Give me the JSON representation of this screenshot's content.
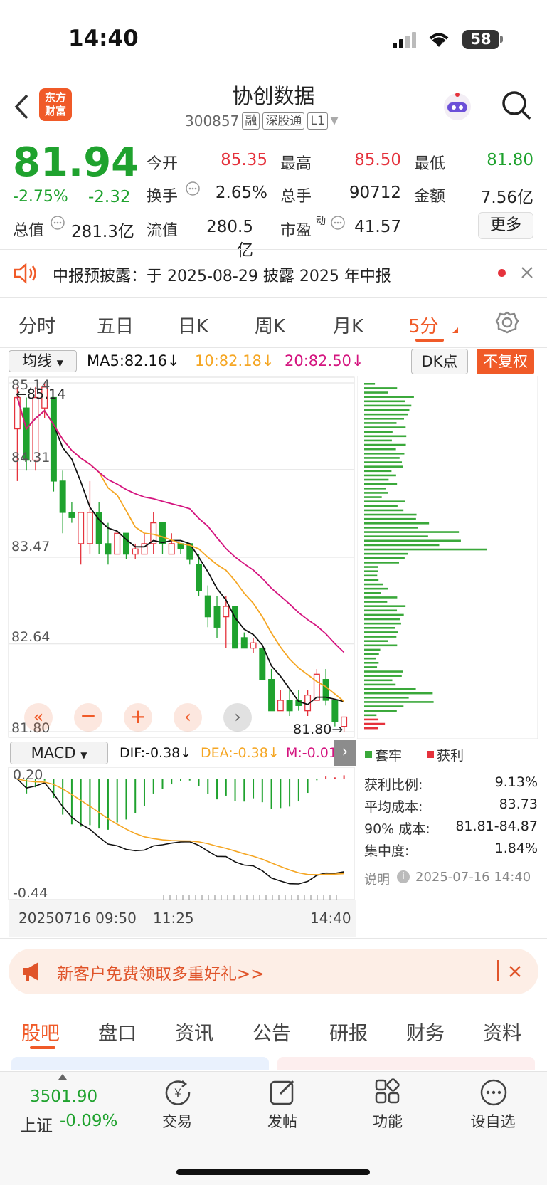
{
  "status": {
    "time": "14:40",
    "battery": "58"
  },
  "header": {
    "logo_line1": "东方",
    "logo_line2": "财富",
    "name": "协创数据",
    "code": "300857",
    "tags": [
      "融",
      "深股通",
      "L1"
    ]
  },
  "quote": {
    "price": "81.94",
    "change_pct": "-2.75%",
    "change": "-2.32",
    "open_label": "今开",
    "open": "85.35",
    "high_label": "最高",
    "high": "85.50",
    "low_label": "最低",
    "low": "81.80",
    "turnover_label": "换手",
    "turnover": "2.65%",
    "volume_label": "总手",
    "volume": "90712",
    "amount_label": "金额",
    "amount": "7.56亿",
    "mcap_label": "总值",
    "mcap": "281.3亿",
    "float_label": "流值",
    "float": "280.5亿",
    "pe_label": "市盈",
    "pe_sup": "动",
    "pe": "41.57",
    "more": "更多"
  },
  "notice": {
    "text": "中报预披露：于 2025-08-29 披露 2025 年中报"
  },
  "tabs": [
    "分时",
    "五日",
    "日K",
    "周K",
    "月K",
    "5分"
  ],
  "indicators": {
    "ma_select": "均线",
    "ma5": "MA5:82.16↓",
    "ma10": "10:82.18↓",
    "ma20": "20:82.50↓",
    "dk": "DK点",
    "fq": "不复权"
  },
  "chart_data": {
    "type": "candlestick",
    "y_ticks": [
      "85.14",
      "84.31",
      "83.47",
      "82.64",
      "81.80"
    ],
    "high_marker": "←85.14",
    "low_marker": "81.80→",
    "x_labels": [
      "20250716 09:50",
      "11:25",
      "14:40"
    ],
    "candles": [
      [
        84.7,
        85.1,
        84.2,
        85.0
      ],
      [
        84.9,
        85.0,
        84.3,
        84.4
      ],
      [
        84.4,
        85.1,
        84.3,
        85.0
      ],
      [
        84.9,
        85.14,
        84.8,
        85.1
      ],
      [
        85.0,
        85.0,
        84.1,
        84.2
      ],
      [
        84.2,
        84.3,
        83.7,
        83.9
      ],
      [
        83.9,
        84.0,
        83.8,
        83.85
      ],
      [
        83.6,
        83.9,
        83.4,
        83.9
      ],
      [
        83.6,
        84.2,
        83.5,
        83.9
      ],
      [
        83.9,
        84.0,
        83.5,
        83.6
      ],
      [
        83.6,
        83.8,
        83.4,
        83.5
      ],
      [
        83.5,
        83.7,
        83.5,
        83.7
      ],
      [
        83.7,
        83.7,
        83.45,
        83.5
      ],
      [
        83.5,
        83.6,
        83.45,
        83.55
      ],
      [
        83.5,
        83.7,
        83.5,
        83.6
      ],
      [
        83.6,
        83.9,
        83.5,
        83.8
      ],
      [
        83.8,
        83.8,
        83.5,
        83.6
      ],
      [
        83.5,
        83.7,
        83.5,
        83.6
      ],
      [
        83.6,
        83.6,
        83.5,
        83.55
      ],
      [
        83.6,
        83.6,
        83.4,
        83.45
      ],
      [
        83.4,
        83.5,
        83.1,
        83.15
      ],
      [
        83.1,
        83.2,
        82.8,
        82.9
      ],
      [
        83.0,
        83.1,
        82.7,
        82.8
      ],
      [
        82.9,
        83.1,
        82.6,
        83.0
      ],
      [
        83.0,
        83.0,
        82.7,
        82.6
      ],
      [
        82.7,
        82.75,
        82.6,
        82.6
      ],
      [
        82.6,
        82.7,
        82.55,
        82.65
      ],
      [
        82.6,
        82.6,
        82.3,
        82.3
      ],
      [
        82.3,
        82.4,
        82.0,
        82.0
      ],
      [
        82.0,
        82.2,
        82.0,
        82.1
      ],
      [
        82.1,
        82.2,
        81.95,
        82.0
      ],
      [
        82.1,
        82.2,
        82.0,
        82.05
      ],
      [
        82.0,
        82.2,
        81.95,
        82.15
      ],
      [
        82.1,
        82.4,
        82.1,
        82.35
      ],
      [
        82.3,
        82.4,
        82.05,
        82.1
      ],
      [
        82.1,
        82.1,
        81.85,
        81.9
      ],
      [
        81.85,
        81.9,
        81.8,
        81.94
      ]
    ],
    "macd_label": "MACD",
    "dif": "DIF:-0.38↓",
    "dea": "DEA:-0.38↓",
    "m": "M:-0.01",
    "macd_ticks": [
      "0.20",
      "-0.44"
    ]
  },
  "chip": {
    "legend_hold": "套牢",
    "legend_profit": "获利",
    "rows": [
      {
        "label": "获利比例:",
        "value": "9.13%"
      },
      {
        "label": "平均成本:",
        "value": "83.73"
      },
      {
        "label": "90% 成本:",
        "value": "81.81-84.87"
      },
      {
        "label": "集中度:",
        "value": "1.84%"
      }
    ],
    "note": "说明",
    "date": "2025-07-16 14:40"
  },
  "ad": {
    "text": "新客户免费领取多重好礼>>"
  },
  "bottom_tabs": [
    "股吧",
    "盘口",
    "资讯",
    "公告",
    "研报",
    "财务",
    "资料"
  ],
  "nav": {
    "index_value": "3501.90",
    "index_name": "上证",
    "index_change": "-0.09%",
    "items": [
      "交易",
      "发帖",
      "功能",
      "设自选"
    ]
  }
}
